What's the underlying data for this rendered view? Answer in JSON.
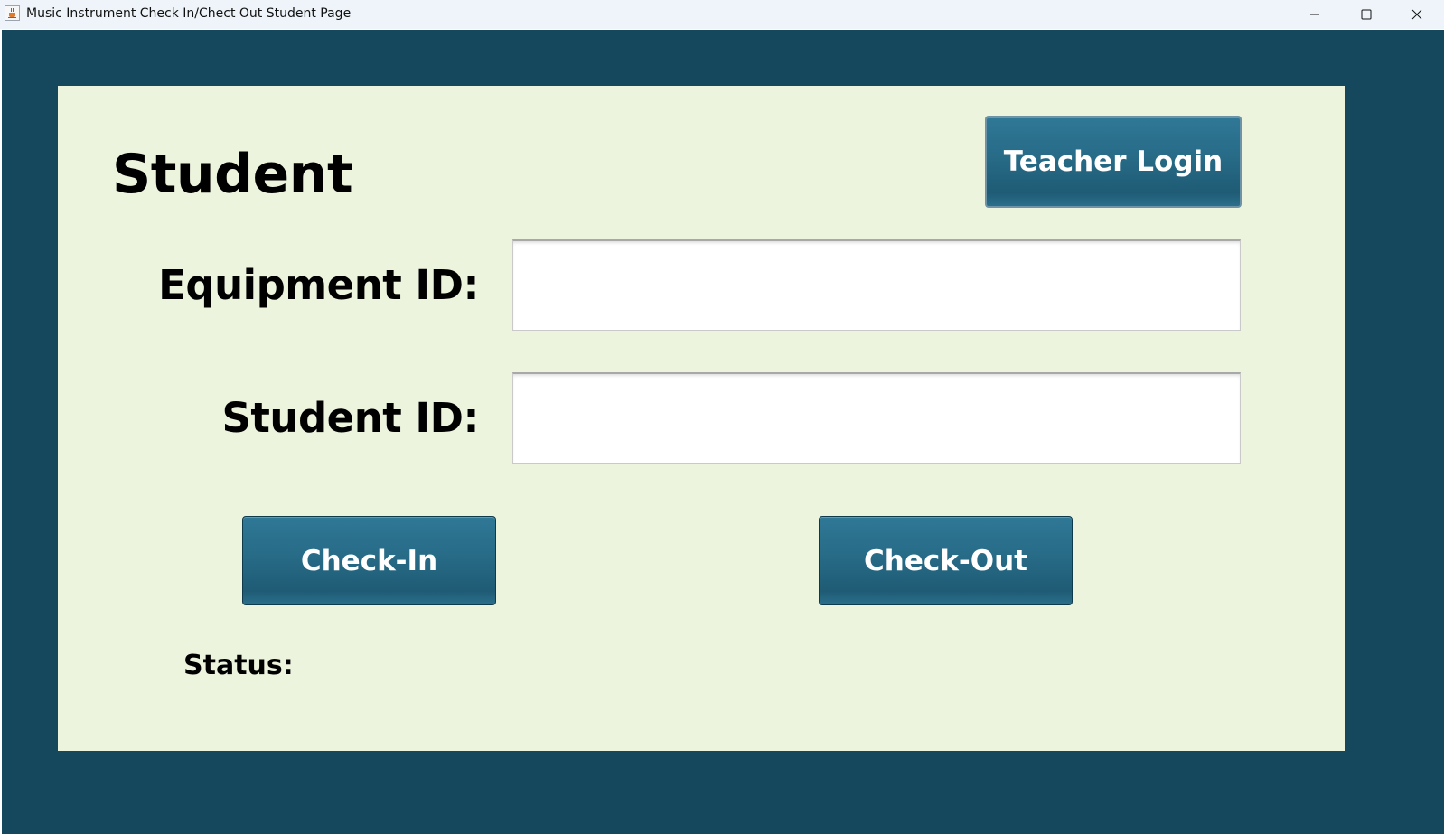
{
  "window": {
    "title": "Music Instrument Check In/Chect Out Student Page",
    "controls": {
      "minimize_icon": "minimize-icon",
      "maximize_icon": "maximize-icon",
      "close_icon": "close-icon"
    }
  },
  "colors": {
    "frame_background": "#15475d",
    "panel_background": "#edf4de",
    "button_background": "#276b87",
    "button_text": "#ffffff",
    "titlebar_background": "#eef4f9"
  },
  "page": {
    "heading": "Student",
    "teacher_login_label": "Teacher Login"
  },
  "form": {
    "equipment_id_label": "Equipment ID:",
    "equipment_id_value": "",
    "student_id_label": "Student ID:",
    "student_id_value": ""
  },
  "actions": {
    "check_in_label": "Check-In",
    "check_out_label": "Check-Out"
  },
  "status": {
    "label": "Status:",
    "value": ""
  }
}
